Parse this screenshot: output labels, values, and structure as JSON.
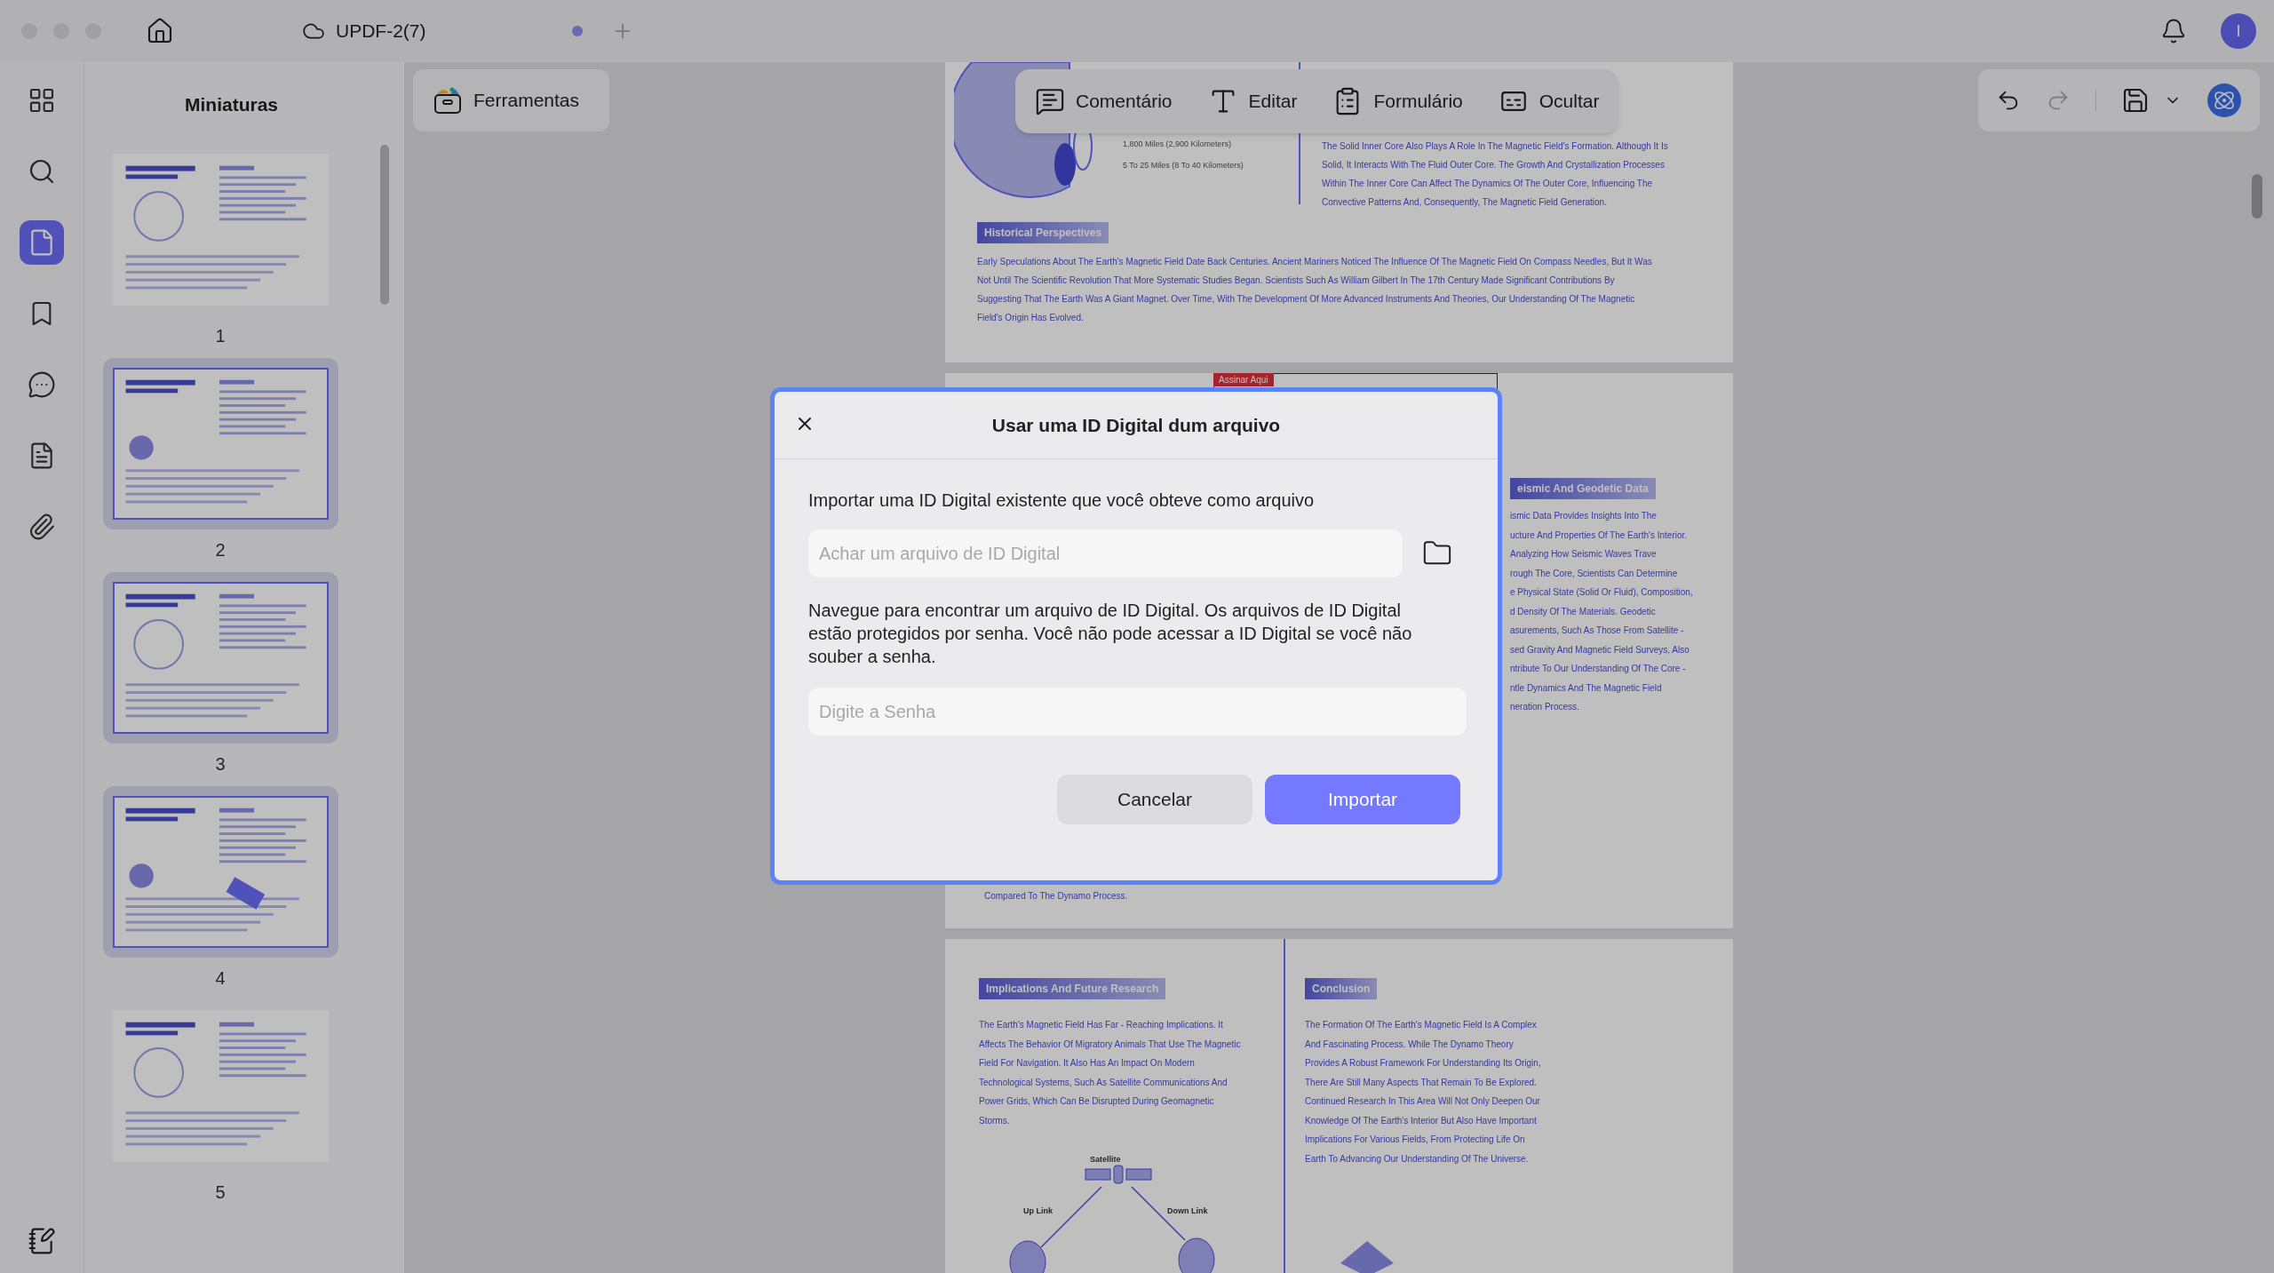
{
  "window": {
    "tab_title": "UPDF-2(7)",
    "unsaved": true,
    "avatar": "I"
  },
  "rail": {
    "items": [
      {
        "kind": "grid",
        "selected": false
      },
      {
        "kind": "search",
        "selected": false
      },
      {
        "kind": "pages",
        "selected": true
      },
      {
        "kind": "bookmark",
        "selected": false
      },
      {
        "kind": "chat",
        "selected": false
      },
      {
        "kind": "document",
        "selected": false
      },
      {
        "kind": "attachment",
        "selected": false
      }
    ]
  },
  "thumbnails": {
    "title": "Miniaturas",
    "pages": [
      {
        "number": "1",
        "selected": false
      },
      {
        "number": "2",
        "selected": true
      },
      {
        "number": "3",
        "selected": true
      },
      {
        "number": "4",
        "selected": true
      },
      {
        "number": "5",
        "selected": false
      }
    ]
  },
  "toolbar": {
    "tools_button": "Ferramentas",
    "modes": [
      {
        "kind": "comment",
        "label": "Comentário"
      },
      {
        "kind": "edit",
        "label": "Editar"
      },
      {
        "kind": "form",
        "label": "Formulário"
      },
      {
        "kind": "redact",
        "label": "Ocultar"
      }
    ]
  },
  "history": {
    "undo_enabled": true,
    "redo_enabled": false
  },
  "document": {
    "page_1": {
      "callouts": [
        "1,800 Miles (2,900 Kilometers)",
        "5 To 25 Miles (8 To 40 Kilometers)"
      ],
      "paragraph": "The Solid Inner Core Also Plays A Role In The Magnetic Field's Formation. Although It Is Solid, It Interacts With The Fluid Outer Core. The Growth And Crystallization Processes Within The Inner Core Can Affect The Dynamics Of The Outer Core, Influencing The Convective Patterns And, Consequently, The Magnetic Field Generation.",
      "section": {
        "heading": "Historical Perspectives",
        "text": "Early Speculations About The Earth's Magnetic Field Date Back Centuries. Ancient Mariners Noticed The Influence Of The Magnetic Field On Compass Needles, But It Was Not Until The Scientific Revolution That More Systematic Studies Began. Scientists Such As William Gilbert In The 17th Century Made Significant Contributions By Suggesting That The Earth Was A Giant Magnet. Over Time, With The Development Of More Advanced Instruments And Theories, Our Understanding Of The Magnetic Field's Origin Has Evolved."
      }
    },
    "page_2": {
      "signature_tag": "Assinar Aqui",
      "section": {
        "heading": "eismic And Geodetic Data",
        "lines": [
          "ismic Data Provides Insights Into The",
          "ucture And Properties Of The Earth's Interior.",
          "Analyzing How Seismic Waves Trave",
          "rough The Core, Scientists Can Determine",
          "e Physical State (Solid Or Fluid), Composition,",
          "d Density Of The Materials. Geodetic",
          "asurements, Such As Those From Satellite -",
          "sed Gravity And Magnetic Field Surveys, Also",
          "ntribute To Our Understanding Of The Core -",
          "ntle Dynamics And The Magnetic Field",
          "neration Process."
        ]
      },
      "footer_line": "Compared To The Dynamo Process."
    },
    "page_3": {
      "sections": [
        {
          "heading": "Implications And Future Research",
          "text": "The Earth's Magnetic Field Has Far - Reaching Implications. It Affects The Behavior Of Migratory Animals That Use The Magnetic Field For Navigation. It Also Has An Impact On Modern Technological Systems, Such As Satellite Communications And Power Grids, Which Can Be Disrupted During Geomagnetic Storms."
        },
        {
          "heading": "Conclusion",
          "text": "The Formation Of The Earth's Magnetic Field Is A Complex And Fascinating Process. While The Dynamo Theory Provides A Robust Framework For Understanding Its Origin, There Are Still Many Aspects That Remain To Be Explored. Continued Research In This Area Will Not Only Deepen Our Knowledge Of The Earth's Interior But Also Have Important Implications For Various Fields, From Protecting Life On Earth To Advancing Our Understanding Of The Universe."
        }
      ],
      "diagram": {
        "satellite": "Satellite",
        "uplink": "Up Link",
        "downlink": "Down Link"
      }
    }
  },
  "dialog": {
    "title": "Usar uma ID Digital dum arquivo",
    "intro": "Importar uma ID Digital existente que você obteve como arquivo",
    "file_field": {
      "placeholder": "Achar um arquivo de ID Digital"
    },
    "description": "Navegue para encontrar um arquivo de ID Digital. Os arquivos de ID Digital estão protegidos por senha. Você não pode acessar a ID Digital se você não souber a senha.",
    "password_field": {
      "placeholder": "Digite a Senha"
    },
    "buttons": [
      {
        "kind": "secondary",
        "label": "Cancelar"
      },
      {
        "kind": "primary",
        "label": "Importar"
      }
    ]
  }
}
